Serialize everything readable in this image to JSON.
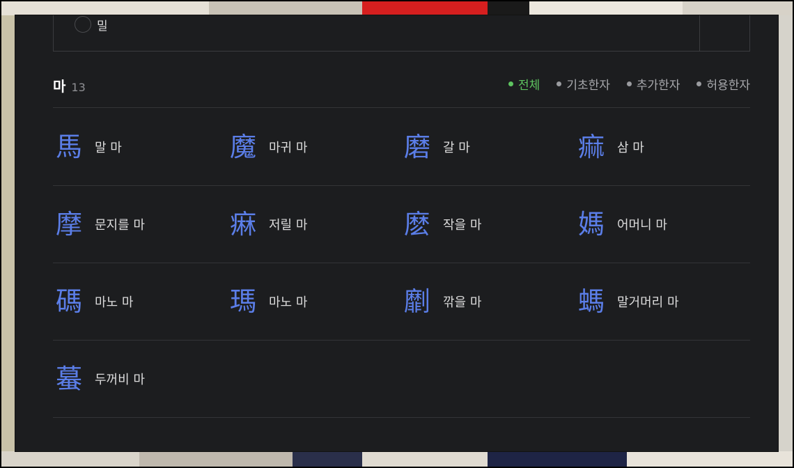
{
  "previous_option": {
    "label": "밀"
  },
  "section": {
    "title": "마",
    "count": "13"
  },
  "filters": [
    {
      "label": "전체",
      "active": true
    },
    {
      "label": "기초한자",
      "active": false
    },
    {
      "label": "추가한자",
      "active": false
    },
    {
      "label": "허용한자",
      "active": false
    }
  ],
  "colors": {
    "accent_green": "#5ec460",
    "hanja_blue": "#5b7ee8",
    "panel_bg": "#1c1d1f"
  },
  "rows": [
    [
      {
        "hanja": "馬",
        "meaning": "말 마"
      },
      {
        "hanja": "魔",
        "meaning": "마귀 마"
      },
      {
        "hanja": "磨",
        "meaning": "갈 마"
      },
      {
        "hanja": "痲",
        "meaning": "삼 마"
      }
    ],
    [
      {
        "hanja": "摩",
        "meaning": "문지를 마"
      },
      {
        "hanja": "痳",
        "meaning": "저릴 마"
      },
      {
        "hanja": "麽",
        "meaning": "작을 마"
      },
      {
        "hanja": "媽",
        "meaning": "어머니 마"
      }
    ],
    [
      {
        "hanja": "碼",
        "meaning": "마노 마"
      },
      {
        "hanja": "瑪",
        "meaning": "마노 마"
      },
      {
        "hanja": "劘",
        "meaning": "깎을 마"
      },
      {
        "hanja": "螞",
        "meaning": "말거머리 마"
      }
    ],
    [
      {
        "hanja": "蟇",
        "meaning": "두꺼비 마"
      }
    ]
  ]
}
